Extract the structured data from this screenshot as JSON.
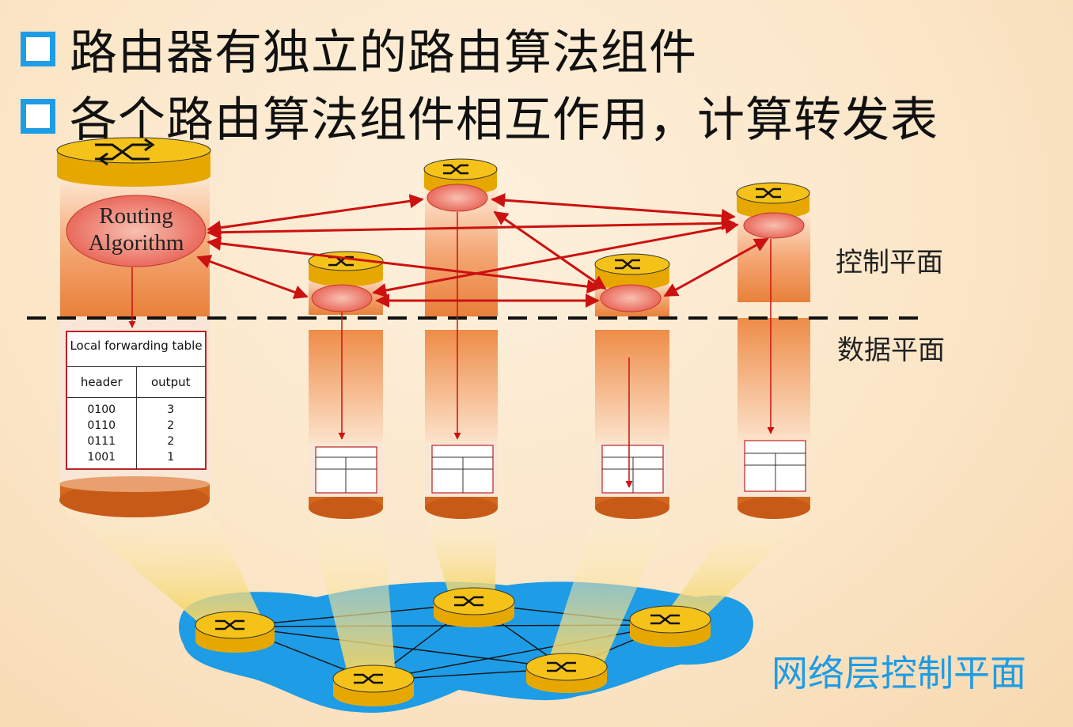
{
  "bullets": [
    {
      "text": "路由器有独立的路由算法组件"
    },
    {
      "text": "各个路由算法组件相互作用，计算转发表"
    }
  ],
  "labels": {
    "control_plane": "控制平面",
    "data_plane": "数据平面",
    "network_control_plane": "网络层控制平面"
  },
  "routing_algorithm": {
    "line1": "Routing",
    "line2": "Algorithm"
  },
  "forwarding_table": {
    "title": "Local forwarding table",
    "col_header": "header",
    "col_output": "output",
    "headers": [
      "0100",
      "0110",
      "0111",
      "1001"
    ],
    "outputs": [
      "3",
      "2",
      "2",
      "1"
    ]
  },
  "colors": {
    "accent": "#1e9ce6",
    "arrow": "#cc1111",
    "router_top": "#f5c21a",
    "cylinder": "#e8803a"
  }
}
